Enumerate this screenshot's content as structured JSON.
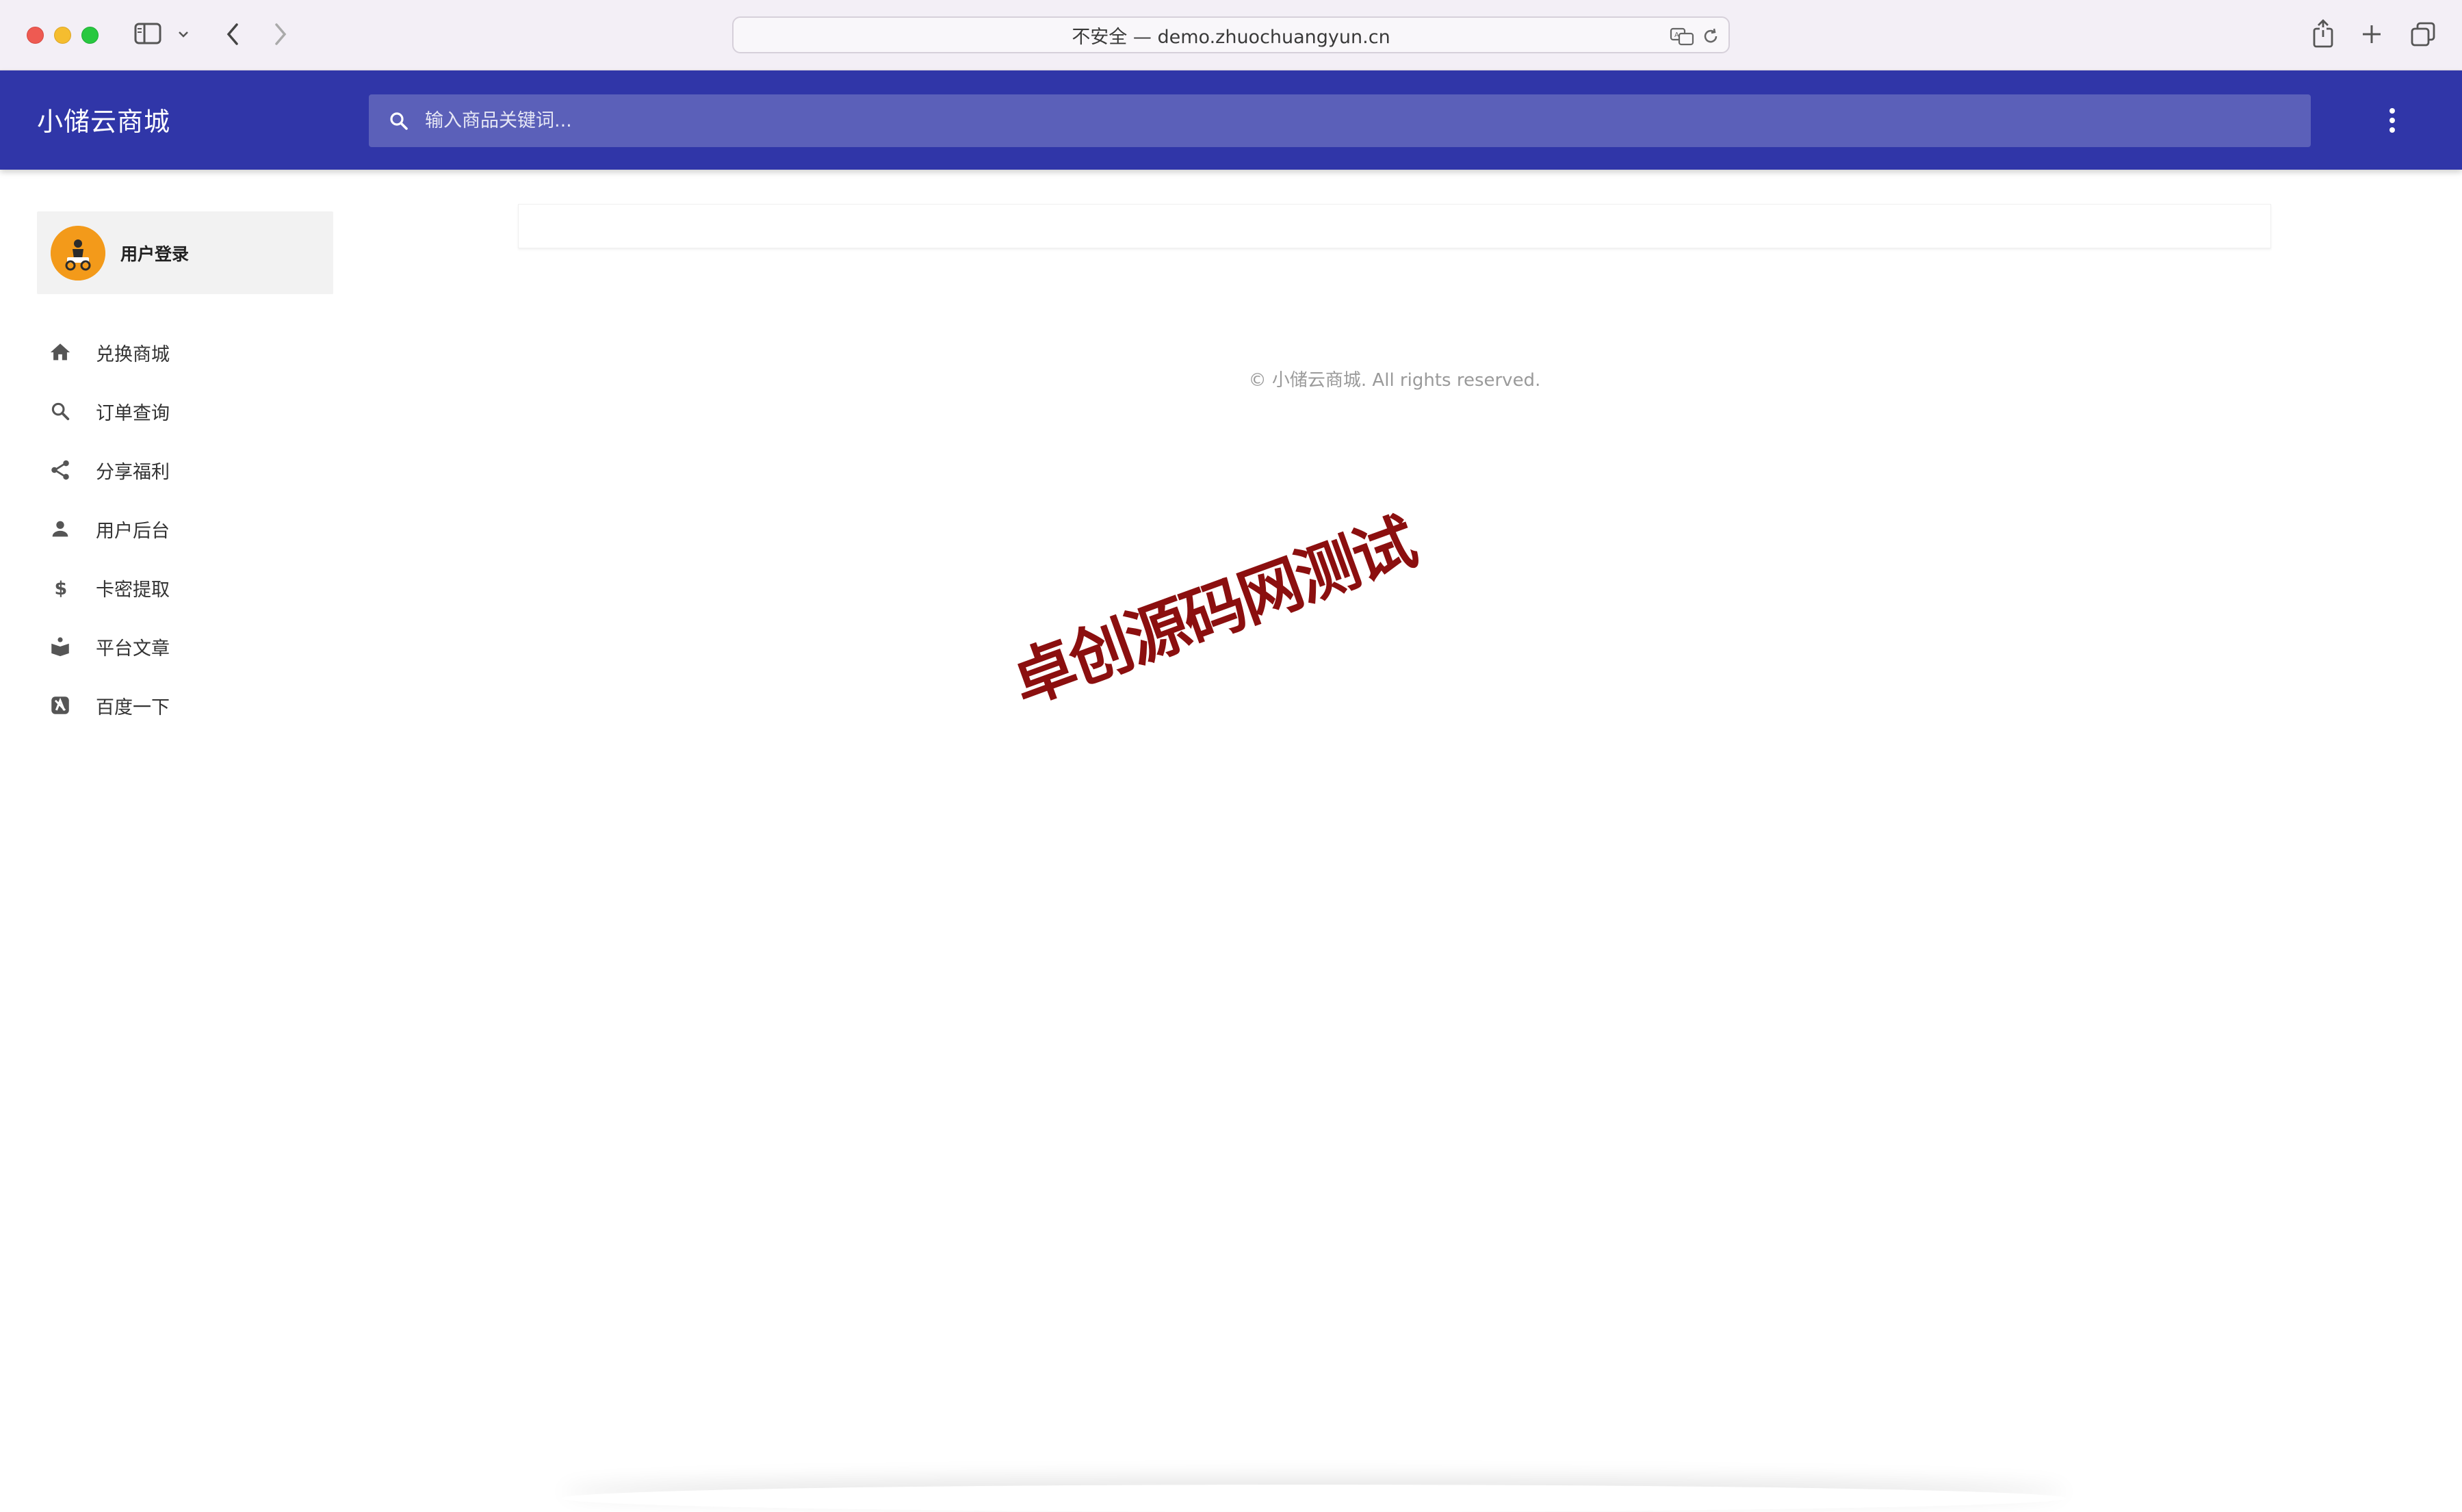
{
  "browser": {
    "address": "不安全 — demo.zhuochuangyun.cn"
  },
  "appbar": {
    "title": "小储云商城",
    "search_placeholder": "输入商品关键词..."
  },
  "sidebar": {
    "user_login": "用户登录",
    "items": [
      {
        "label": "兑换商城",
        "icon": "home-icon"
      },
      {
        "label": "订单查询",
        "icon": "search-icon"
      },
      {
        "label": "分享福利",
        "icon": "share-icon"
      },
      {
        "label": "用户后台",
        "icon": "person-icon"
      },
      {
        "label": "卡密提取",
        "icon": "dollar-icon"
      },
      {
        "label": "平台文章",
        "icon": "book-icon"
      },
      {
        "label": "百度一下",
        "icon": "baidu-icon"
      }
    ]
  },
  "main": {
    "footer": "© 小储云商城. All rights reserved.",
    "watermark": "卓创源码网测试"
  },
  "colors": {
    "appbar": "#3036a8",
    "search_bg": "#5b60b9",
    "avatar": "#f39a1a",
    "watermark": "#8b0f0f"
  }
}
